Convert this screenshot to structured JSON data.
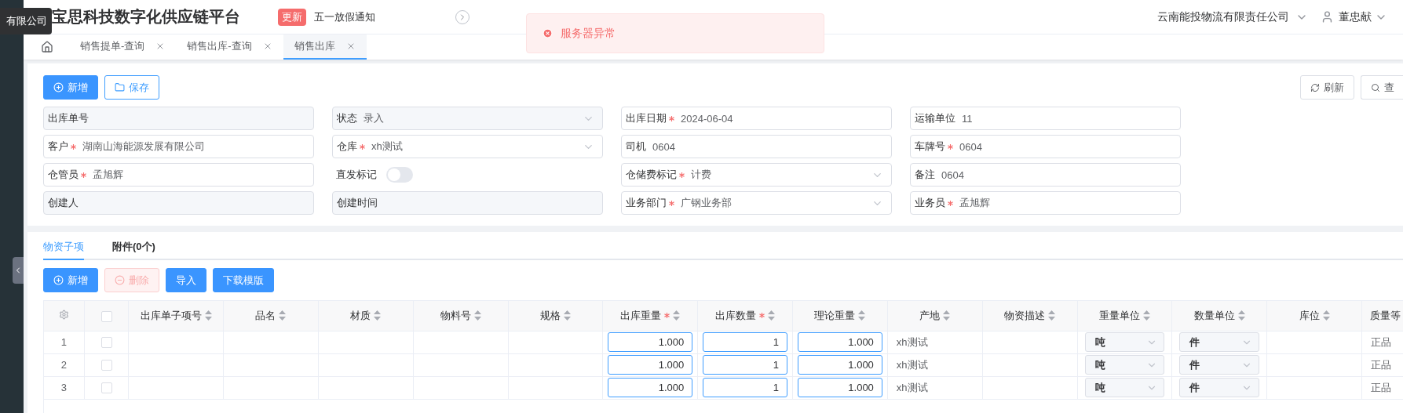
{
  "tooltip": {
    "text": "有限公司"
  },
  "header": {
    "title": "宝思科技数字化供应链平台",
    "notice_badge": "更新",
    "notice_text": "五一放假通知",
    "company": "云南能投物流有限责任公司",
    "user": "董忠献"
  },
  "toast": {
    "text": "服务器异常"
  },
  "tabs": [
    {
      "label": "销售提单-查询",
      "selected": false
    },
    {
      "label": "销售出库-查询",
      "selected": false
    },
    {
      "label": "销售出库",
      "selected": true
    }
  ],
  "toolbar": {
    "left": [
      {
        "label": "新增",
        "kind": "primary"
      },
      {
        "label": "保存",
        "kind": "outline"
      }
    ],
    "right": [
      {
        "label": "刷新",
        "kind": "refresh"
      },
      {
        "label": "查",
        "kind": "search"
      }
    ]
  },
  "form": [
    {
      "label": "出库单号",
      "required": false,
      "kind": "input",
      "disabled": true
    },
    {
      "label": "状态",
      "required": false,
      "kind": "select",
      "value": "录入",
      "disabled": true
    },
    {
      "label": "出库日期",
      "required": true,
      "kind": "input",
      "value": "2024-06-04",
      "disabled": false
    },
    {
      "label": "运输单位",
      "required": false,
      "kind": "input",
      "value": "11",
      "disabled": false
    },
    {
      "label": "客户",
      "required": true,
      "kind": "input",
      "value": "湖南山海能源发展有限公司",
      "disabled": false
    },
    {
      "label": "仓库",
      "required": true,
      "kind": "select",
      "value": "xh测试",
      "disabled": false
    },
    {
      "label": "司机",
      "required": false,
      "kind": "input",
      "value": "0604",
      "disabled": false
    },
    {
      "label": "车牌号",
      "required": true,
      "kind": "input",
      "value": "0604",
      "disabled": false
    },
    {
      "label": "仓管员",
      "required": true,
      "kind": "input",
      "value": "孟旭辉",
      "disabled": false
    },
    {
      "label": "直发标记",
      "required": false,
      "kind": "switch",
      "on": false
    },
    {
      "label": "仓储费标记",
      "required": true,
      "kind": "select",
      "value": "计费",
      "disabled": false
    },
    {
      "label": "备注",
      "required": false,
      "kind": "input",
      "value": "0604",
      "disabled": false
    },
    {
      "label": "创建人",
      "required": false,
      "kind": "input",
      "disabled": true
    },
    {
      "label": "创建时间",
      "required": false,
      "kind": "input",
      "disabled": true
    },
    {
      "label": "业务部门",
      "required": true,
      "kind": "select",
      "value": "广钢业务部",
      "disabled": false
    },
    {
      "label": "业务员",
      "required": true,
      "kind": "input",
      "value": "孟旭辉",
      "disabled": false
    }
  ],
  "detail_tabs": [
    {
      "label": "物资子项",
      "selected": true
    },
    {
      "label": "附件(0个)",
      "selected": false
    }
  ],
  "detail_buttons": [
    {
      "label": "新增",
      "kind": "primary",
      "disabled": false
    },
    {
      "label": "删除",
      "kind": "danger",
      "disabled": true
    },
    {
      "label": "导入",
      "kind": "plain",
      "disabled": false
    },
    {
      "label": "下载模版",
      "kind": "plain",
      "disabled": false
    }
  ],
  "table": {
    "select_all": {
      "checked": false
    },
    "columns": [
      {
        "label": "出库单子项号",
        "required": false
      },
      {
        "label": "品名",
        "required": false
      },
      {
        "label": "材质",
        "required": false
      },
      {
        "label": "物料号",
        "required": false
      },
      {
        "label": "规格",
        "required": false
      },
      {
        "label": "出库重量",
        "required": true
      },
      {
        "label": "出库数量",
        "required": true
      },
      {
        "label": "理论重量",
        "required": false
      },
      {
        "label": "产地",
        "required": false
      },
      {
        "label": "物资描述",
        "required": false
      },
      {
        "label": "重量单位",
        "required": false
      },
      {
        "label": "数量单位",
        "required": false
      },
      {
        "label": "库位",
        "required": false
      },
      {
        "label": "质量等",
        "required": false
      }
    ],
    "rows": [
      {
        "index": "1",
        "checked": false,
        "cells": [
          {
            "kind": "text"
          },
          {
            "kind": "text"
          },
          {
            "kind": "text"
          },
          {
            "kind": "text"
          },
          {
            "kind": "text"
          },
          {
            "kind": "input",
            "value": "1.000"
          },
          {
            "kind": "input",
            "value": "1"
          },
          {
            "kind": "input",
            "value": "1.000"
          },
          {
            "kind": "text",
            "value": "xh测试"
          },
          {
            "kind": "text"
          },
          {
            "kind": "select",
            "value": "吨"
          },
          {
            "kind": "select",
            "value": "件"
          },
          {
            "kind": "text"
          },
          {
            "kind": "text",
            "value": "正品"
          }
        ]
      },
      {
        "index": "2",
        "checked": false,
        "cells": [
          {
            "kind": "text"
          },
          {
            "kind": "text"
          },
          {
            "kind": "text"
          },
          {
            "kind": "text"
          },
          {
            "kind": "text"
          },
          {
            "kind": "input",
            "value": "1.000"
          },
          {
            "kind": "input",
            "value": "1"
          },
          {
            "kind": "input",
            "value": "1.000"
          },
          {
            "kind": "text",
            "value": "xh测试"
          },
          {
            "kind": "text"
          },
          {
            "kind": "select",
            "value": "吨"
          },
          {
            "kind": "select",
            "value": "件"
          },
          {
            "kind": "text"
          },
          {
            "kind": "text",
            "value": "正品"
          }
        ]
      },
      {
        "index": "3",
        "checked": false,
        "cells": [
          {
            "kind": "text"
          },
          {
            "kind": "text"
          },
          {
            "kind": "text"
          },
          {
            "kind": "text"
          },
          {
            "kind": "text"
          },
          {
            "kind": "input",
            "value": "1.000"
          },
          {
            "kind": "input",
            "value": "1"
          },
          {
            "kind": "input",
            "value": "1.000"
          },
          {
            "kind": "text",
            "value": "xh测试"
          },
          {
            "kind": "text"
          },
          {
            "kind": "select",
            "value": "吨"
          },
          {
            "kind": "select",
            "value": "件"
          },
          {
            "kind": "text"
          },
          {
            "kind": "text",
            "value": "正品"
          }
        ]
      }
    ]
  }
}
